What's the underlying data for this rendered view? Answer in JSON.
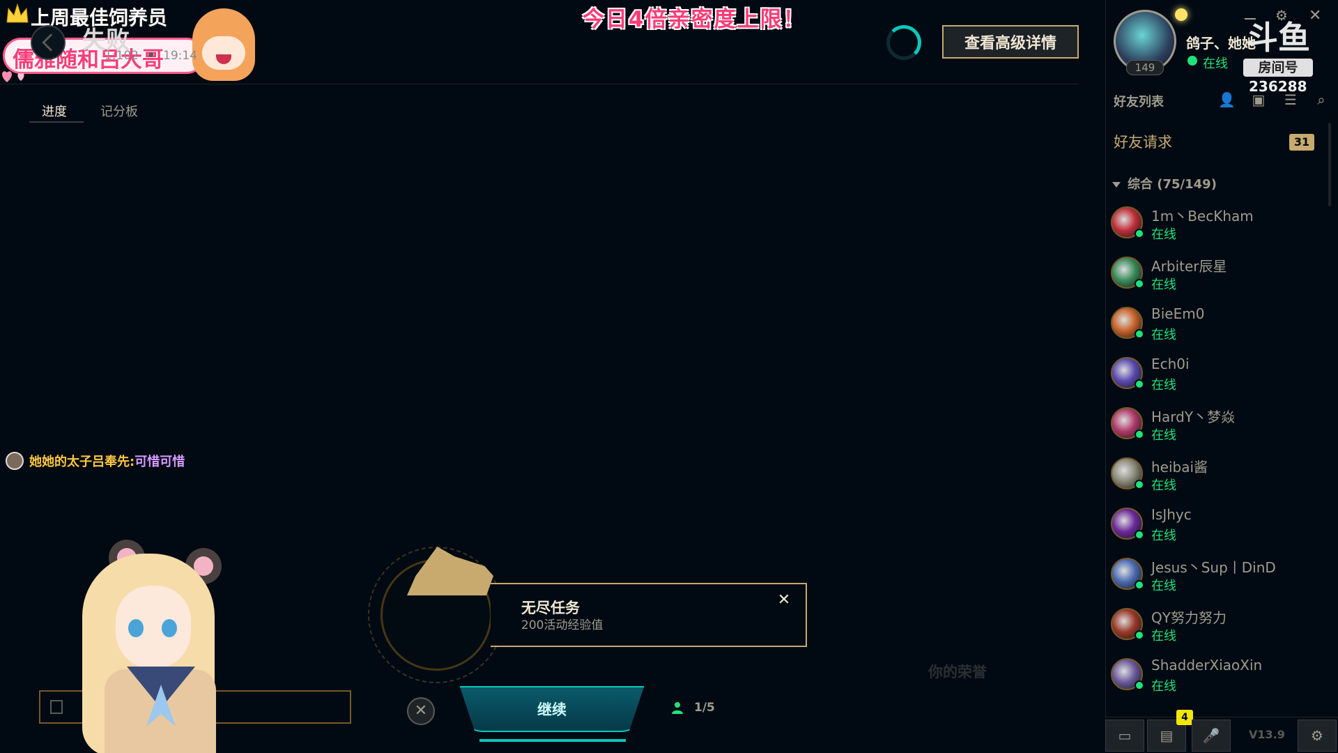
{
  "stream_overlay": {
    "title_banner": "今日4倍亲密度上限！",
    "top_label": "上周最佳饲养员",
    "top_name": "儒雅随和吕大哥",
    "room_label": "房间号",
    "room_number": "236288"
  },
  "match": {
    "result": "失败",
    "stat": "1:102",
    "time": "19:14",
    "details_button": "查看高级详情"
  },
  "tabs": [
    {
      "label": "进度"
    },
    {
      "label": "记分板"
    }
  ],
  "chat": {
    "user": "她她的太子吕奉先:",
    "message": "可惜可惜"
  },
  "mission": {
    "title": "无尽任务",
    "reward": "200活动经验值"
  },
  "controls": {
    "continue": "继续",
    "party_count": "1/5",
    "honor_text": "你的荣誉"
  },
  "profile": {
    "name": "鸽子、她她",
    "level": "149",
    "status": "在线"
  },
  "friends": {
    "header": "好友列表",
    "requests_label": "好友请求",
    "requests_count": "31",
    "group_label": "综合 (75/149)",
    "list": [
      {
        "name": "1m丶BecKham",
        "status": "在线",
        "color": "#c0303a"
      },
      {
        "name": "Arbiter辰星",
        "status": "在线",
        "color": "#3a8a5a"
      },
      {
        "name": "BieEm0",
        "status": "在线",
        "color": "#c8642a"
      },
      {
        "name": "Ech0i",
        "status": "在线",
        "color": "#5a4ab0"
      },
      {
        "name": "HardY丶梦焱",
        "status": "在线",
        "color": "#b03a6a"
      },
      {
        "name": "heibai酱",
        "status": "在线",
        "color": "#8a8a7a"
      },
      {
        "name": "IsJhyc",
        "status": "在线",
        "color": "#6a2a9a"
      },
      {
        "name": "Jesus丶Sup丨DinD",
        "status": "在线",
        "color": "#4a6ab0"
      },
      {
        "name": "QY努力努力",
        "status": "在线",
        "color": "#9a3a2a"
      },
      {
        "name": "ShadderXiaoXin",
        "status": "在线",
        "color": "#6a5a9a"
      }
    ]
  },
  "bottom_bar": {
    "missions_badge": "4",
    "version": "V13.9"
  },
  "colors": {
    "gold": "#c8aa6e",
    "teal": "#0ac8b9",
    "online": "#1ee37a",
    "background": "#010a13"
  }
}
